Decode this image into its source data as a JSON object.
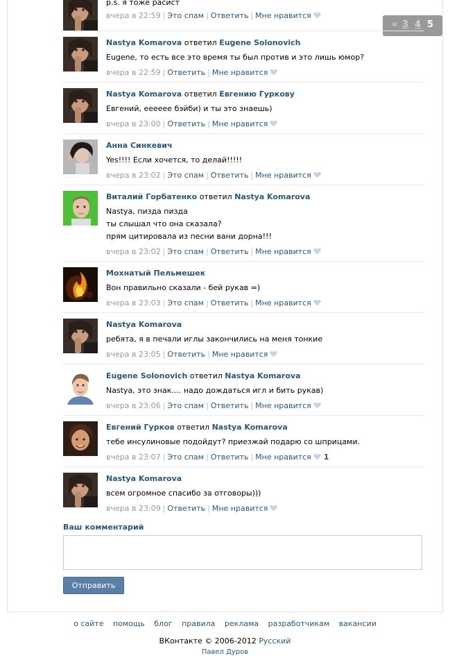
{
  "pager": {
    "prev": "«",
    "pages": [
      "3",
      "4",
      "5"
    ]
  },
  "comments": [
    {
      "avatar": "nastya",
      "author": "",
      "verb": "",
      "target": "",
      "lines": [
        "p.s. я тоже расист"
      ],
      "time": "вчера в 22:59",
      "actions": {
        "spam": "Это спам",
        "reply": "Ответить",
        "like": "Мне нравится"
      },
      "likes": ""
    },
    {
      "avatar": "nastya",
      "author": "Nastya Komarova",
      "verb": "ответил",
      "target": "Eugene Solonovich",
      "lines": [
        "Eugene, то есть все это время ты был против и это лишь юмор?"
      ],
      "time": "вчера в 22:59",
      "actions": {
        "spam": "",
        "reply": "Ответить",
        "like": "Мне нравится"
      },
      "likes": ""
    },
    {
      "avatar": "nastya",
      "author": "Nastya Komarova",
      "verb": "ответил",
      "target": "Евгению Гуркову",
      "lines": [
        "Евгений, ееееее бэйби) и ты это знаешь)"
      ],
      "time": "вчера в 23:00",
      "actions": {
        "spam": "",
        "reply": "Ответить",
        "like": "Мне нравится"
      },
      "likes": ""
    },
    {
      "avatar": "anna",
      "author": "Анна Синкевич",
      "verb": "",
      "target": "",
      "lines": [
        "Yes!!!! Если хочется, то делай!!!!!"
      ],
      "time": "вчера в 23:02",
      "actions": {
        "spam": "Это спам",
        "reply": "Ответить",
        "like": "Мне нравится"
      },
      "likes": ""
    },
    {
      "avatar": "vitaly",
      "author": "Виталий Горбатенко",
      "verb": "ответил",
      "target": "Nastya Komarova",
      "lines": [
        "Nastya, пизда пизда",
        "ты слышал что она сказала?",
        "прям цитировала из песни вани дорна!!!"
      ],
      "time": "вчера в 23:02",
      "actions": {
        "spam": "Это спам",
        "reply": "Ответить",
        "like": "Мне нравится"
      },
      "likes": ""
    },
    {
      "avatar": "fire",
      "author": "Мохнатый Пельмешек",
      "verb": "",
      "target": "",
      "lines": [
        "Вон правильно сказали - бей рукав =)"
      ],
      "time": "вчера в 23:03",
      "actions": {
        "spam": "Это спам",
        "reply": "Ответить",
        "like": "Мне нравится"
      },
      "likes": ""
    },
    {
      "avatar": "nastya",
      "author": "Nastya Komarova",
      "verb": "",
      "target": "",
      "lines": [
        "ребята, я в печали иглы закончились на меня тонкие"
      ],
      "time": "вчера в 23:05",
      "actions": {
        "spam": "",
        "reply": "Ответить",
        "like": "Мне нравится"
      },
      "likes": ""
    },
    {
      "avatar": "eugene",
      "author": "Eugene Solonovich",
      "verb": "ответил",
      "target": "Nastya Komarova",
      "lines": [
        "Nastya, это знак.... надо дождаться игл и бить рукав)"
      ],
      "time": "вчера в 23:06",
      "actions": {
        "spam": "Это спам",
        "reply": "Ответить",
        "like": "Мне нравится"
      },
      "likes": ""
    },
    {
      "avatar": "gurkov",
      "author": "Евгений Гурков",
      "verb": "ответил",
      "target": "Nastya Komarova",
      "lines": [
        "тебе инсулиновые подойдут? приезжай подарю со шприцами."
      ],
      "time": "вчера в 23:07",
      "actions": {
        "spam": "Это спам",
        "reply": "Ответить",
        "like": "Мне нравится"
      },
      "likes": "1"
    },
    {
      "avatar": "nastya",
      "author": "Nastya Komarova",
      "verb": "",
      "target": "",
      "lines": [
        "всем огромное спасибо за отговоры)))"
      ],
      "time": "вчера в 23:09",
      "actions": {
        "spam": "",
        "reply": "Ответить",
        "like": "Мне нравится"
      },
      "likes": ""
    }
  ],
  "reply_form": {
    "label": "Ваш комментарий",
    "value": "",
    "send_label": "Отправить"
  },
  "footer": {
    "links": [
      "о сайте",
      "помощь",
      "блог",
      "правила",
      "реклама",
      "разработчикам",
      "вакансии"
    ],
    "copyright": "ВКонтакте © 2006-2012",
    "language": "Русский",
    "author": "Павел Дуров"
  },
  "colors": {
    "link": "#2b587a",
    "meta": "#999999",
    "button": "#5b7fa6",
    "pager_bg": "#999999"
  }
}
